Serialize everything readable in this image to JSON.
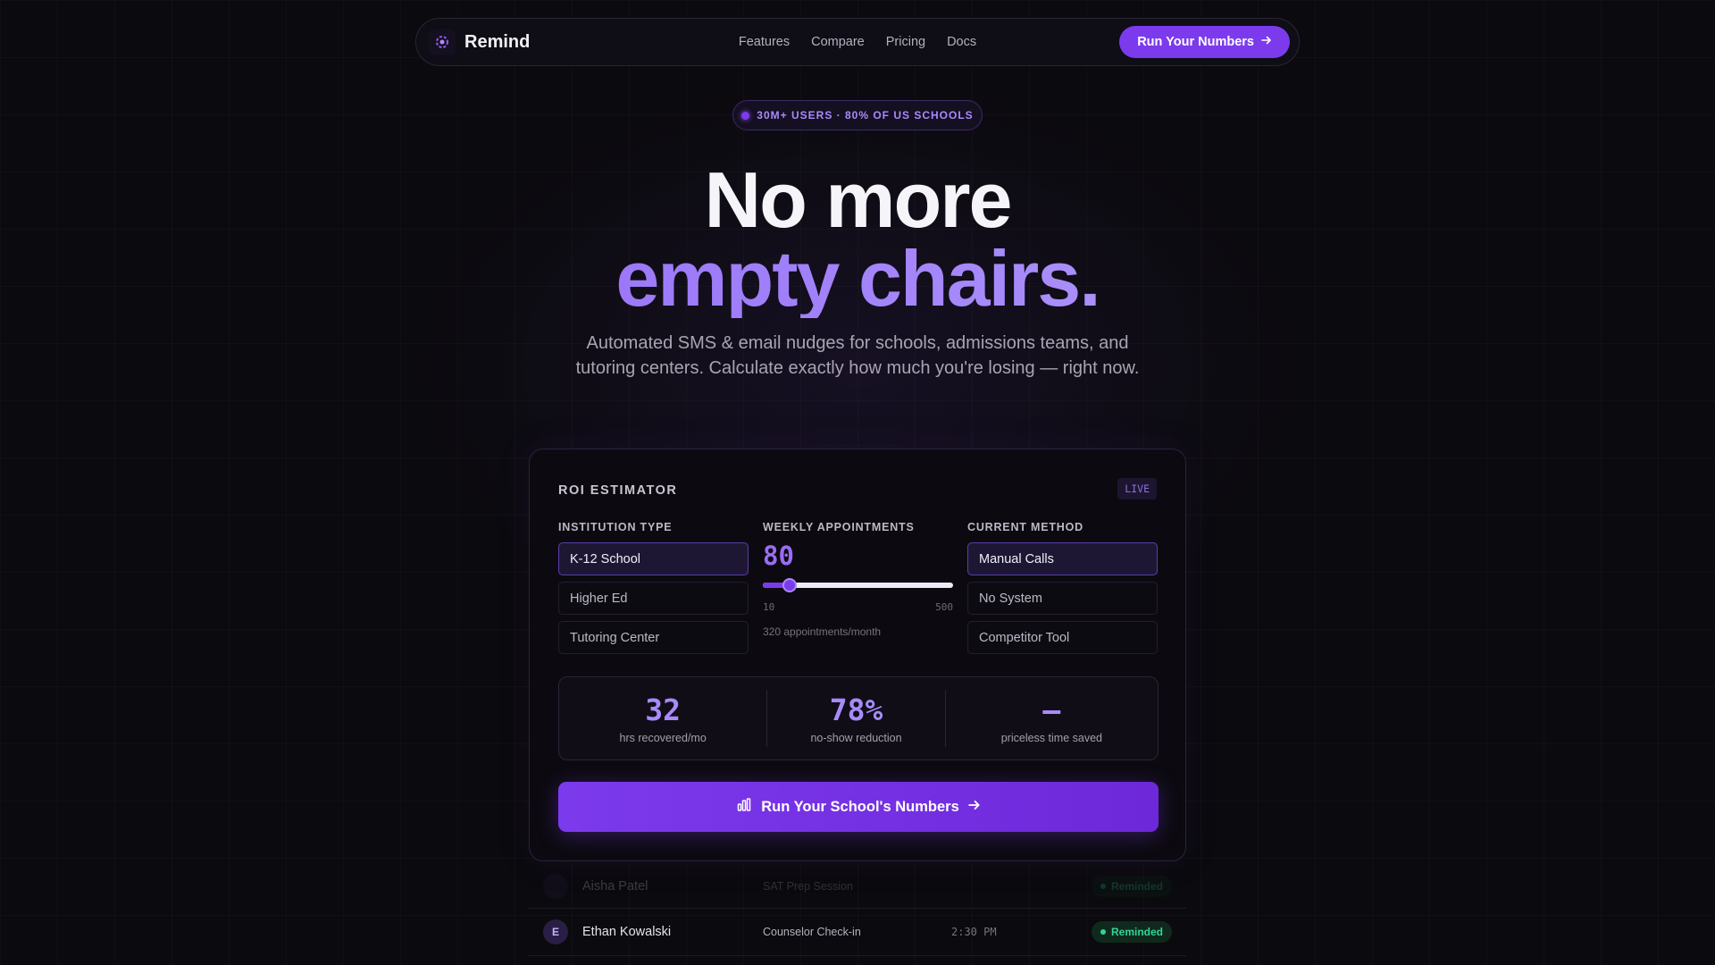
{
  "nav": {
    "brand": "Remind",
    "links": [
      "Features",
      "Compare",
      "Pricing",
      "Docs"
    ],
    "cta": "Run Your Numbers"
  },
  "hero": {
    "badge": "30M+ USERS · 80% OF US SCHOOLS",
    "title_line1": "No more",
    "title_line2": "empty chairs.",
    "subtitle": "Automated SMS & email nudges for schools, admissions teams, and tutoring centers. Calculate exactly how much you're losing — right now."
  },
  "roi": {
    "title": "ROI ESTIMATOR",
    "live_badge": "LIVE",
    "institution": {
      "label": "INSTITUTION TYPE",
      "options": [
        "K-12 School",
        "Higher Ed",
        "Tutoring Center"
      ],
      "selected": "K-12 School"
    },
    "appointments": {
      "label": "WEEKLY APPOINTMENTS",
      "value": "80",
      "min": "10",
      "max": "500",
      "fraction": 0.143,
      "monthly_note": "320 appointments/month"
    },
    "method": {
      "label": "CURRENT METHOD",
      "options": [
        "Manual Calls",
        "No System",
        "Competitor Tool"
      ],
      "selected": "Manual Calls"
    },
    "stats": [
      {
        "value": "32",
        "label": "hrs recovered/mo"
      },
      {
        "value": "78%",
        "label": "no-show reduction"
      },
      {
        "value": "—",
        "label": "priceless time saved"
      }
    ],
    "cta": "Run Your School's Numbers"
  },
  "appointments_list": [
    {
      "initial": "",
      "name": "Aisha Patel",
      "type": "SAT Prep Session",
      "time": "",
      "status": "Reminded"
    },
    {
      "initial": "E",
      "name": "Ethan Kowalski",
      "type": "Counselor Check-in",
      "time": "2:30 PM",
      "status": "Reminded"
    }
  ],
  "colors": {
    "accent": "#7c3aed",
    "accent_light": "#a78bfa",
    "success": "#34d399",
    "background": "#0b0a0e"
  }
}
